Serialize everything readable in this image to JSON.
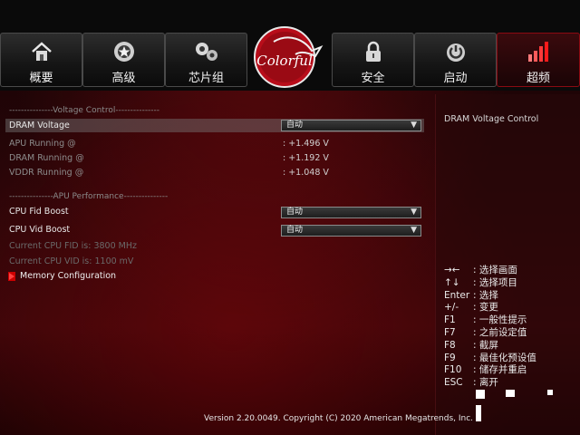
{
  "tabs": [
    {
      "label": "概要",
      "icon": "home-icon"
    },
    {
      "label": "高级",
      "icon": "star-gear-icon"
    },
    {
      "label": "芯片组",
      "icon": "gears-icon"
    },
    {
      "label": "安全",
      "icon": "lock-icon"
    },
    {
      "label": "启动",
      "icon": "power-icon"
    },
    {
      "label": "超频",
      "icon": "bars-icon"
    }
  ],
  "logo_text": "Colorful",
  "sections": {
    "voltage": "---------------Voltage Control---------------",
    "apu": "---------------APU Performance---------------"
  },
  "rows": {
    "dram_voltage": {
      "label": "DRAM Voltage",
      "value": "自动"
    },
    "apu_running": {
      "label": "APU  Running @",
      "value": ": +1.496 V"
    },
    "dram_running": {
      "label": "DRAM Running @",
      "value": ": +1.192 V"
    },
    "vddr_running": {
      "label": "VDDR Running @",
      "value": ": +1.048 V"
    },
    "cpu_fid": {
      "label": "CPU Fid Boost",
      "value": "自动"
    },
    "cpu_vid": {
      "label": "CPU Vid Boost",
      "value": "自动"
    },
    "current_fid": {
      "label": "Current CPU FID is: 3800 MHz"
    },
    "current_vid": {
      "label": "Current CPU VID is: 1100 mV"
    },
    "memory_config": {
      "label": "Memory Configuration"
    }
  },
  "help": {
    "title": "DRAM Voltage Control"
  },
  "keys": [
    {
      "key": "→←",
      "desc": ": 选择画面"
    },
    {
      "key": "↑↓",
      "desc": ": 选择项目"
    },
    {
      "key": "Enter",
      "desc": ": 选择"
    },
    {
      "key": "+/-",
      "desc": ": 变更"
    },
    {
      "key": "F1",
      "desc": ": 一般性提示"
    },
    {
      "key": "F7",
      "desc": ": 之前设定值"
    },
    {
      "key": "F8",
      "desc": ": 截屏"
    },
    {
      "key": "F9",
      "desc": ": 最佳化预设值"
    },
    {
      "key": "F10",
      "desc": ": 储存并重启"
    },
    {
      "key": "ESC",
      "desc": ": 离开"
    }
  ],
  "footer": "Version 2.20.0049. Copyright (C) 2020 American Megatrends, Inc.",
  "colors": {
    "accent": "#8a0a12",
    "highlight": "#7a7a7a"
  }
}
